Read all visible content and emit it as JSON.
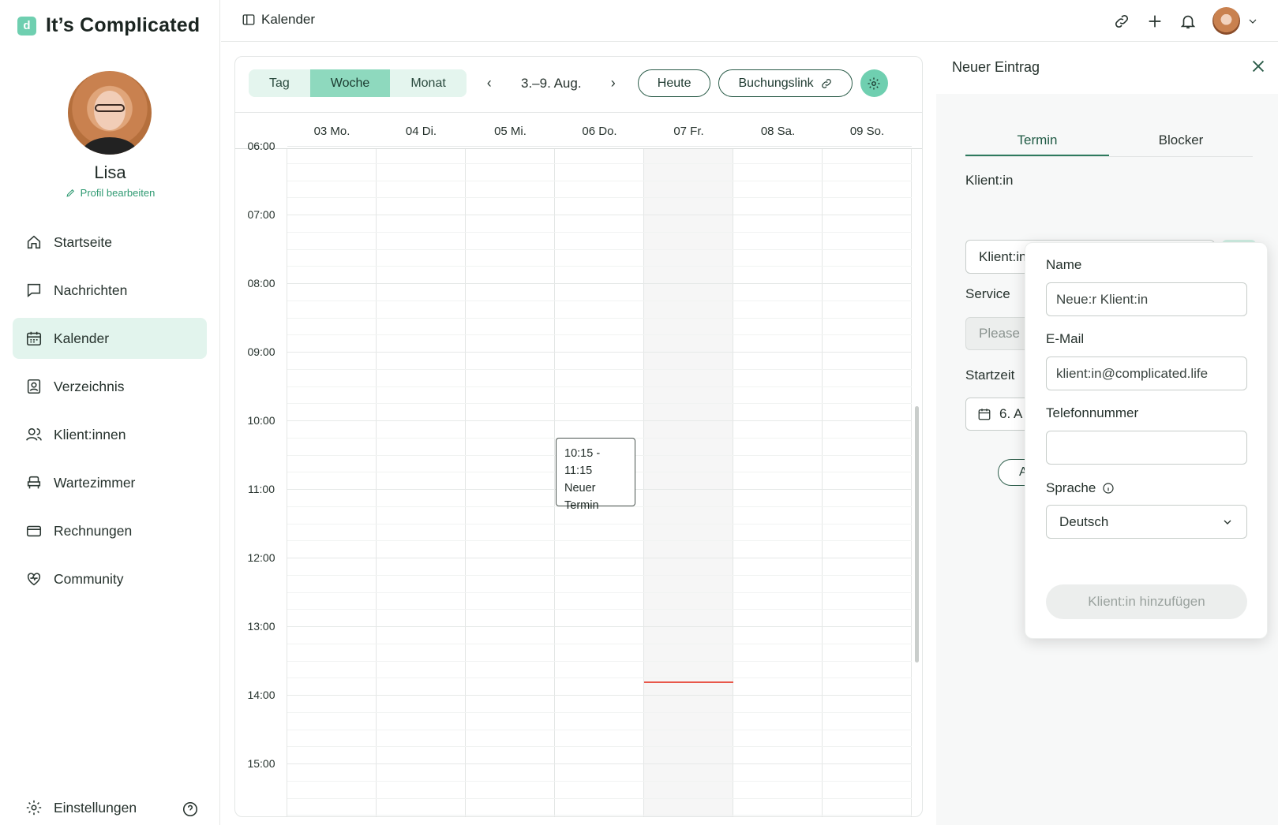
{
  "brand": {
    "mark": "d",
    "name": "It’s Complicated"
  },
  "profile": {
    "name": "Lisa",
    "edit_label": "Profil bearbeiten"
  },
  "nav": {
    "items": [
      {
        "label": "Startseite",
        "icon": "home-icon"
      },
      {
        "label": "Nachrichten",
        "icon": "message-icon"
      },
      {
        "label": "Kalender",
        "icon": "calendar-icon",
        "active": true
      },
      {
        "label": "Verzeichnis",
        "icon": "directory-icon"
      },
      {
        "label": "Klient:innen",
        "icon": "users-icon"
      },
      {
        "label": "Wartezimmer",
        "icon": "waiting-room-icon"
      },
      {
        "label": "Rechnungen",
        "icon": "card-icon"
      },
      {
        "label": "Community",
        "icon": "heart-icon"
      }
    ],
    "settings_label": "Einstellungen"
  },
  "topbar": {
    "title": "Kalender"
  },
  "calendar": {
    "views": [
      "Tag",
      "Woche",
      "Monat"
    ],
    "active_view": "Woche",
    "range": "3.–9. Aug.",
    "today_label": "Heute",
    "booking_label": "Buchungslink",
    "days": [
      "03 Mo.",
      "04 Di.",
      "05 Mi.",
      "06 Do.",
      "07 Fr.",
      "08 Sa.",
      "09 So."
    ],
    "today_index": 4,
    "hours": [
      "06:00",
      "07:00",
      "08:00",
      "09:00",
      "10:00",
      "11:00",
      "12:00",
      "13:00",
      "14:00",
      "15:00"
    ],
    "event": {
      "time": "10:15 - 11:15",
      "line1": "Neuer",
      "line2": "Termin",
      "day_index": 3
    }
  },
  "panel": {
    "title": "Neuer Eintrag",
    "tabs": [
      "Termin",
      "Blocker"
    ],
    "active_tab": "Termin",
    "client_label": "Klient:in",
    "client_select": "Klient:in auswählen",
    "service_label": "Service",
    "service_placeholder": "Please",
    "start_label": "Startzeit",
    "start_value": "6. A",
    "pill_fragment": "A"
  },
  "popover": {
    "name_label": "Name",
    "name_value": "Neue:r Klient:in",
    "email_label": "E-Mail",
    "email_value": "klient:in@complicated.life",
    "phone_label": "Telefonnummer",
    "phone_value": "",
    "language_label": "Sprache",
    "language_value": "Deutsch",
    "submit_label": "Klient:in hinzufügen"
  },
  "colors": {
    "accent": "#6fcfb0",
    "accent_light": "#e2f4ed",
    "now_line": "#e8574a",
    "brand_green": "#2e7a5e"
  }
}
